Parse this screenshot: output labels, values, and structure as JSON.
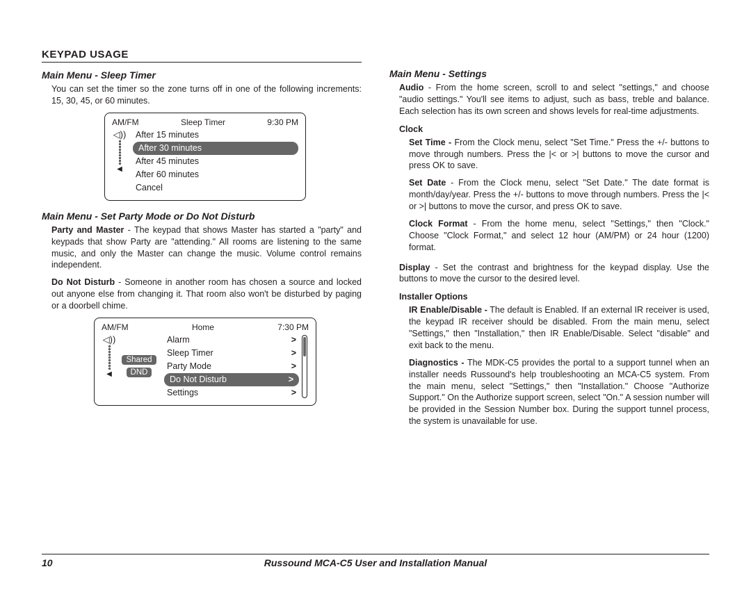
{
  "header": {
    "title": "KEYPAD USAGE"
  },
  "left": {
    "sleep": {
      "title": "Main Menu - Sleep Timer",
      "intro": "You can set the timer so the zone turns off in one of the following increments: 15, 30, 45, or 60 minutes.",
      "keypad": {
        "top_left": "AM/FM",
        "top_center": "Sleep Timer",
        "top_right": "9:30 PM",
        "items": [
          "After 15 minutes",
          "After 30 minutes",
          "After 45 minutes",
          "After 60 minutes",
          "Cancel"
        ],
        "selected_index": 1
      }
    },
    "party": {
      "title": "Main Menu - Set Party Mode or Do Not Disturb",
      "para1_label": "Party and Master",
      "para1_rest": " - The keypad that shows Master has started a \"party\" and keypads that show Party are \"attending.\" All rooms are listening to the same music, and only the Master can change the music. Volume control remains independent.",
      "para2_label": "Do Not Disturb",
      "para2_rest": " - Someone in another room has chosen a source and locked out anyone else from changing it. That room also won't be disturbed by paging or a doorbell chime.",
      "keypad": {
        "top_left": "AM/FM",
        "top_center": "Home",
        "top_right": "7:30 PM",
        "badges": [
          "Shared",
          "DND"
        ],
        "items": [
          "Alarm",
          "Sleep Timer",
          "Party Mode",
          "Do Not Disturb",
          "Settings"
        ],
        "selected_index": 3
      }
    }
  },
  "right": {
    "title": "Main Menu - Settings",
    "audio_label": "Audio",
    "audio_rest": " - From the home screen, scroll to and select \"settings,\" and choose \"audio settings.\" You'll see items to adjust, such as bass, treble and balance. Each selection has its own screen and shows levels for real-time adjustments.",
    "clock_heading": "Clock",
    "clock": {
      "set_time_label": "Set Time -",
      "set_time_rest": " From the Clock menu, select \"Set Time.\" Press the +/- buttons to move through numbers. Press the |< or >| buttons to move the cursor and press OK to save.",
      "set_date_label": "Set Date",
      "set_date_rest": " - From the Clock menu, select \"Set Date.\" The date format is month/day/year. Press the +/- buttons to move through numbers. Press the |< or >| buttons to move the cursor, and press OK to save.",
      "format_label": "Clock Format",
      "format_rest": " - From the home menu, select \"Settings,\" then \"Clock.\" Choose \"Clock Format,\" and select 12 hour (AM/PM) or 24 hour (1200) format."
    },
    "display_label": "Display",
    "display_rest": " - Set the contrast and brightness for the keypad display. Use the buttons to move the cursor to the desired level.",
    "installer_heading": "Installer Options",
    "installer": {
      "ir_label": "IR Enable/Disable -",
      "ir_rest": " The default is Enabled. If an external IR receiver is used, the keypad IR receiver should be disabled. From the main menu, select \"Settings,\" then \"Installation,\" then IR Enable/Disable. Select \"disable\" and exit back to the menu.",
      "diag_label": "Diagnostics -",
      "diag_rest": " The MDK-C5 provides the portal to a support tunnel when an installer needs Russound's help troubleshooting an MCA-C5 system. From the main menu, select \"Settings,\" then \"Installation.\" Choose \"Authorize Support.\" On the Authorize support screen, select \"On.\" A session number will be provided in the Session Number box. During the support tunnel process, the system is unavailable for use."
    }
  },
  "footer": {
    "page": "10",
    "title": "Russound MCA-C5 User and Installation Manual"
  },
  "chevron": ">"
}
